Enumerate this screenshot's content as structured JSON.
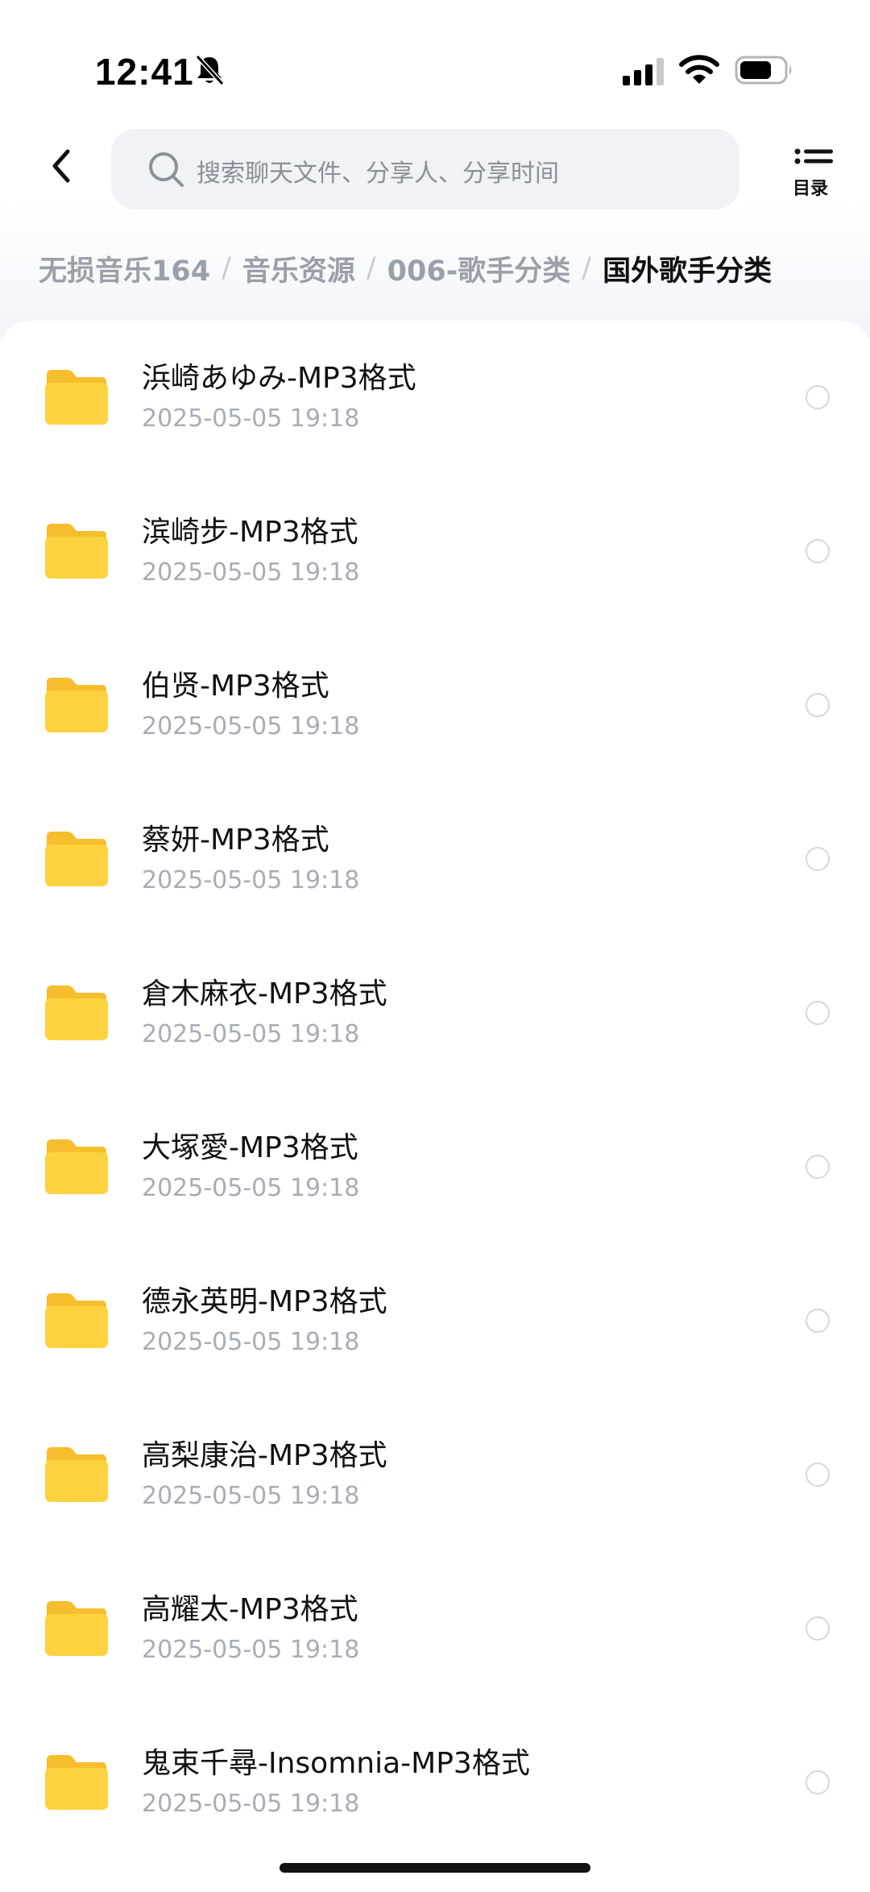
{
  "status_bar": {
    "time": "12:41",
    "icons": [
      "bell-muted-icon",
      "signal-icon",
      "wifi-icon",
      "battery-icon"
    ]
  },
  "header": {
    "back_icon": "chevron-left-icon",
    "search_placeholder": "搜索聊天文件、分享人、分享时间",
    "menu_label": "目录"
  },
  "breadcrumb": [
    "无损音乐164",
    "音乐资源",
    "006-歌手分类",
    "国外歌手分类"
  ],
  "folders": [
    {
      "name": "浜崎あゆみ-MP3格式",
      "date": "2025-05-05 19:18"
    },
    {
      "name": "滨崎步-MP3格式",
      "date": "2025-05-05 19:18"
    },
    {
      "name": "伯贤-MP3格式",
      "date": "2025-05-05 19:18"
    },
    {
      "name": "蔡妍-MP3格式",
      "date": "2025-05-05 19:18"
    },
    {
      "name": "倉木麻衣-MP3格式",
      "date": "2025-05-05 19:18"
    },
    {
      "name": "大塚愛-MP3格式",
      "date": "2025-05-05 19:18"
    },
    {
      "name": "德永英明-MP3格式",
      "date": "2025-05-05 19:18"
    },
    {
      "name": "高梨康治-MP3格式",
      "date": "2025-05-05 19:18"
    },
    {
      "name": "高耀太-MP3格式",
      "date": "2025-05-05 19:18"
    },
    {
      "name": "鬼束千尋-Insomnia-MP3格式",
      "date": "2025-05-05 19:18"
    }
  ],
  "colors": {
    "folder": "#fdd23f",
    "folder_tab": "#f6be2c",
    "accent_text": "#111111",
    "muted_text": "#a8adb5"
  }
}
